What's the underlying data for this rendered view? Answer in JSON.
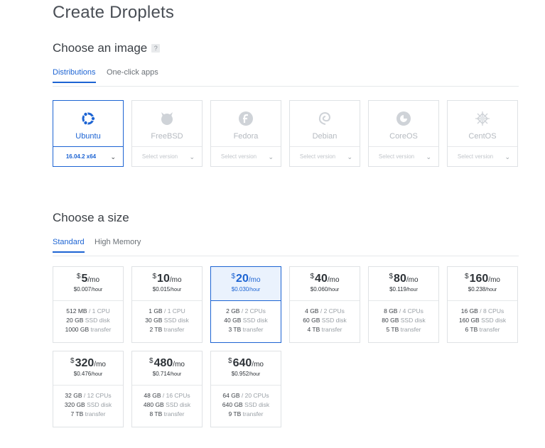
{
  "page": {
    "title": "Create Droplets"
  },
  "image_section": {
    "title": "Choose an image",
    "help": "?",
    "tabs": [
      {
        "label": "Distributions",
        "active": true
      },
      {
        "label": "One-click apps",
        "active": false
      }
    ],
    "images": [
      {
        "name": "Ubuntu",
        "version": "16.04.2 x64",
        "icon": "ubuntu-icon",
        "selected": true
      },
      {
        "name": "FreeBSD",
        "version": "Select version",
        "icon": "freebsd-icon",
        "selected": false
      },
      {
        "name": "Fedora",
        "version": "Select version",
        "icon": "fedora-icon",
        "selected": false
      },
      {
        "name": "Debian",
        "version": "Select version",
        "icon": "debian-icon",
        "selected": false
      },
      {
        "name": "CoreOS",
        "version": "Select version",
        "icon": "coreos-icon",
        "selected": false
      },
      {
        "name": "CentOS",
        "version": "Select version",
        "icon": "centos-icon",
        "selected": false
      }
    ]
  },
  "size_section": {
    "title": "Choose a size",
    "tabs": [
      {
        "label": "Standard",
        "active": true
      },
      {
        "label": "High Memory",
        "active": false
      }
    ],
    "currency": "$",
    "per_month": "/mo",
    "per_hour": "/hour",
    "sizes": [
      {
        "monthly": "5",
        "hourly": "$0.007",
        "memory": "512 MB",
        "cpu": "1 CPU",
        "disk": "20 GB",
        "disk_label": "SSD disk",
        "transfer": "1000 GB",
        "transfer_label": "transfer",
        "selected": false
      },
      {
        "monthly": "10",
        "hourly": "$0.015",
        "memory": "1 GB",
        "cpu": "1 CPU",
        "disk": "30 GB",
        "disk_label": "SSD disk",
        "transfer": "2 TB",
        "transfer_label": "transfer",
        "selected": false
      },
      {
        "monthly": "20",
        "hourly": "$0.030",
        "memory": "2 GB",
        "cpu": "2 CPUs",
        "disk": "40 GB",
        "disk_label": "SSD disk",
        "transfer": "3 TB",
        "transfer_label": "transfer",
        "selected": true
      },
      {
        "monthly": "40",
        "hourly": "$0.060",
        "memory": "4 GB",
        "cpu": "2 CPUs",
        "disk": "60 GB",
        "disk_label": "SSD disk",
        "transfer": "4 TB",
        "transfer_label": "transfer",
        "selected": false
      },
      {
        "monthly": "80",
        "hourly": "$0.119",
        "memory": "8 GB",
        "cpu": "4 CPUs",
        "disk": "80 GB",
        "disk_label": "SSD disk",
        "transfer": "5 TB",
        "transfer_label": "transfer",
        "selected": false
      },
      {
        "monthly": "160",
        "hourly": "$0.238",
        "memory": "16 GB",
        "cpu": "8 CPUs",
        "disk": "160 GB",
        "disk_label": "SSD disk",
        "transfer": "6 TB",
        "transfer_label": "transfer",
        "selected": false
      },
      {
        "monthly": "320",
        "hourly": "$0.476",
        "memory": "32 GB",
        "cpu": "12 CPUs",
        "disk": "320 GB",
        "disk_label": "SSD disk",
        "transfer": "7 TB",
        "transfer_label": "transfer",
        "selected": false
      },
      {
        "monthly": "480",
        "hourly": "$0.714",
        "memory": "48 GB",
        "cpu": "16 CPUs",
        "disk": "480 GB",
        "disk_label": "SSD disk",
        "transfer": "8 TB",
        "transfer_label": "transfer",
        "selected": false
      },
      {
        "monthly": "640",
        "hourly": "$0.952",
        "memory": "64 GB",
        "cpu": "20 CPUs",
        "disk": "640 GB",
        "disk_label": "SSD disk",
        "transfer": "9 TB",
        "transfer_label": "transfer",
        "selected": false
      }
    ]
  },
  "colors": {
    "accent": "#1d64d3",
    "selected_bg": "#eaf2fd",
    "border": "#dfe2e5",
    "muted": "#b5bac0"
  }
}
